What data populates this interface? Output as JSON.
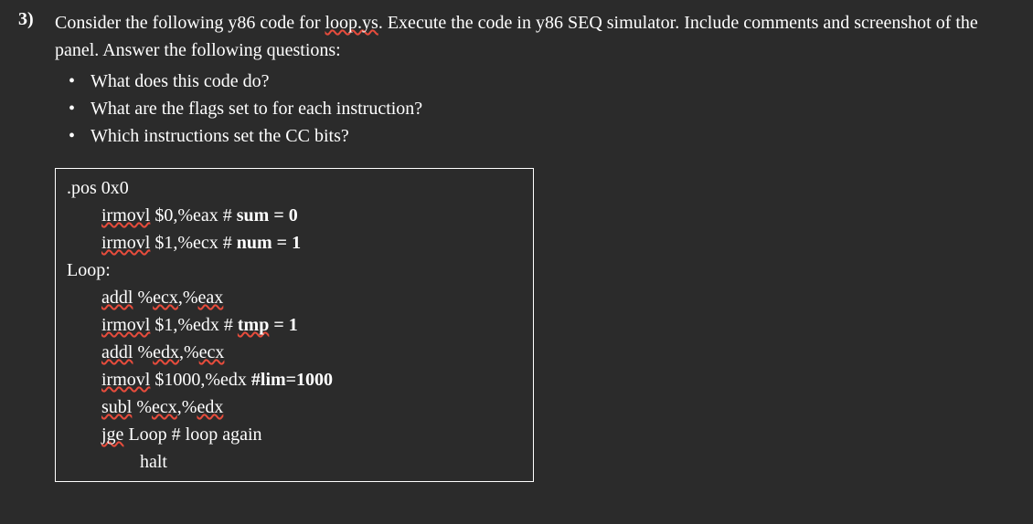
{
  "question": {
    "number": "3)",
    "text_part1": "Consider the following y86 code for ",
    "text_wavy1": "loop.ys",
    "text_part2": ". Execute the code in y86 SEQ simulator. Include comments and screenshot of the panel. Answer the following questions:",
    "bullets": [
      "What does this code do?",
      "What are the flags set to for each instruction?",
      "Which instructions set the CC bits?"
    ]
  },
  "code": {
    "l1": ".pos 0x0",
    "l2_wavy": "irmovl",
    "l2_rest": " $0,%eax # ",
    "l2_bold": "sum = 0",
    "l3_wavy": "irmovl",
    "l3_rest": " $1,%ecx # ",
    "l3_bold": "num = 1",
    "l4": "Loop:",
    "l5_wavy1": "addl",
    "l5_mid": " %",
    "l5_wavy2": "ecx",
    "l5_mid2": ",%",
    "l5_wavy3": "eax",
    "l6_wavy": "irmovl",
    "l6_rest": " $1,%edx # ",
    "l6_wavy2": "tmp",
    "l6_bold": " = 1",
    "l7_wavy1": "addl",
    "l7_mid": " %",
    "l7_wavy2": "edx",
    "l7_mid2": ",%",
    "l7_wavy3": "ecx",
    "l8_wavy": "irmovl",
    "l8_rest": " $1000,%edx ",
    "l8_bold": "#lim=1000",
    "l9_wavy1": "subl",
    "l9_mid": " %",
    "l9_wavy2": "ecx",
    "l9_mid2": ",%",
    "l9_wavy3": "edx",
    "l10_wavy": "jge",
    "l10_rest": " Loop # loop again",
    "l11": "halt"
  }
}
